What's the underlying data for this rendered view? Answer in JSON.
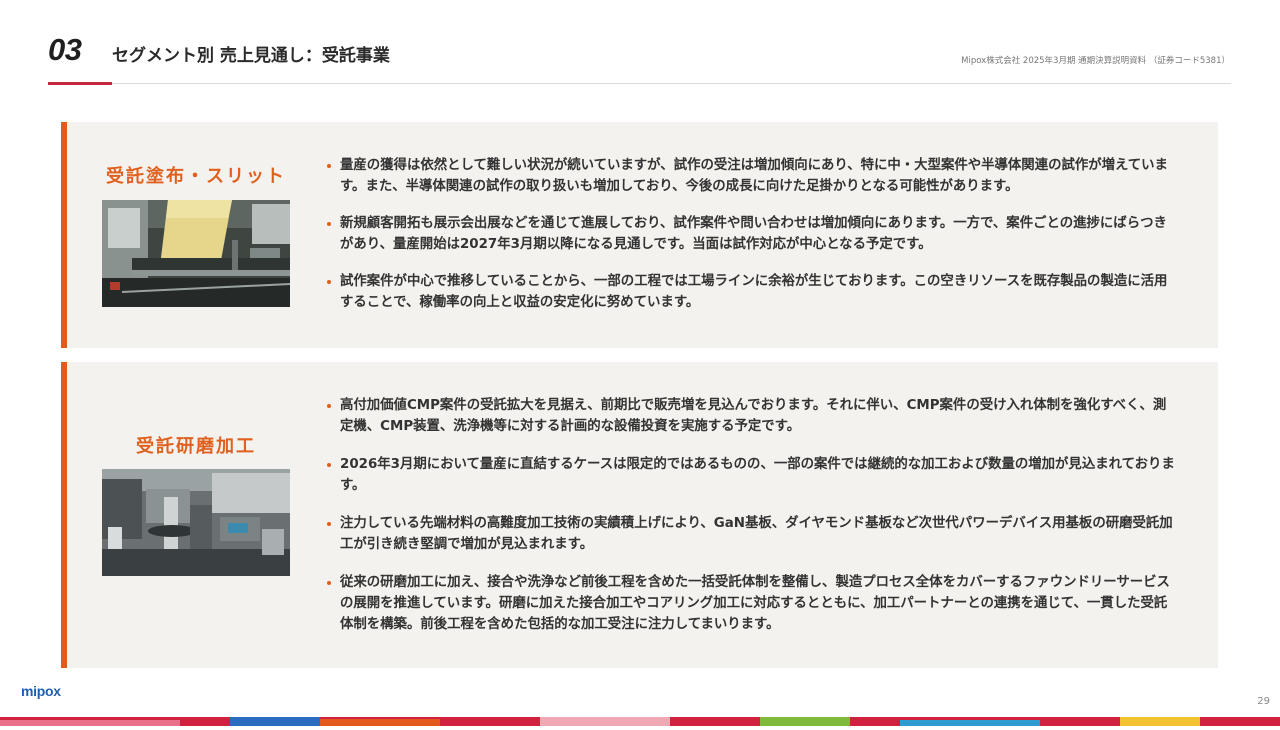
{
  "header": {
    "section_number": "03",
    "title": "セグメント別 売上見通し：受託事業",
    "company_note": "Mipox株式会社 2025年3月期 通期決算説明資料 （証券コード5381）"
  },
  "panels": [
    {
      "title": "受託塗布・スリット",
      "bullets": [
        "量産の獲得は依然として難しい状況が続いていますが、試作の受注は増加傾向にあり、特に中・大型案件や半導体関連の試作が増えています。また、半導体関連の試作の取り扱いも増加しており、今後の成長に向けた足掛かりとなる可能性があります。",
        "新規顧客開拓も展示会出展などを通じて進展しており、試作案件や問い合わせは増加傾向にあります。一方で、案件ごとの進捗にばらつきがあり、量産開始は2027年3月期以降になる見通しです。当面は試作対応が中心となる予定です。",
        "試作案件が中心で推移していることから、一部の工程では工場ラインに余裕が生じております。この空きリソースを既存製品の製造に活用することで、稼働率の向上と収益の安定化に努めています。"
      ]
    },
    {
      "title": "受託研磨加工",
      "bullets": [
        "高付加価値CMP案件の受託拡大を見据え、前期比で販売増を見込んでおります。それに伴い、CMP案件の受け入れ体制を強化すべく、測定機、CMP装置、洗浄機等に対する計画的な設備投資を実施する予定です。",
        "2026年3月期において量産に直結するケースは限定的ではあるものの、一部の案件では継続的な加工および数量の増加が見込まれております。",
        "注力している先端材料の高難度加工技術の実績積上げにより、GaN基板、ダイヤモンド基板など次世代パワーデバイス用基板の研磨受託加工が引き続き堅調で増加が見込まれます。",
        "従来の研磨加工に加え、接合や洗浄など前後工程を含めた一括受託体制を整備し、製造プロセス全体をカバーするファウンドリーサービスの展開を推進しています。研磨に加えた接合加工やコアリング加工に対応するとともに、加工パートナーとの連携を通じて、一貫した受託体制を構築。前後工程を含めた包括的な加工受注に注力してまいります。"
      ]
    }
  ],
  "footer": {
    "logo": "mipox",
    "page_number": "29"
  },
  "colors": {
    "accent_orange": "#e25a1c",
    "accent_red": "#c5283d",
    "panel_bg": "#f4f2ef",
    "logo_blue": "#1d5fb4"
  }
}
